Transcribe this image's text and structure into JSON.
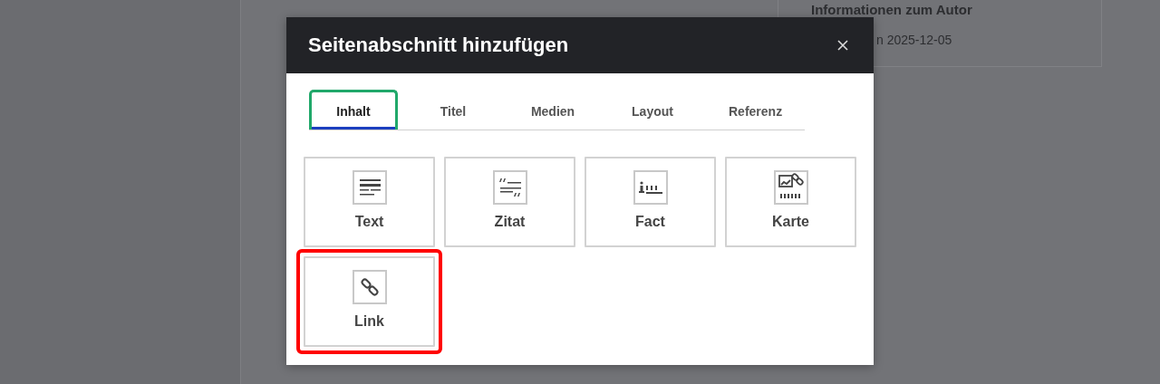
{
  "background": {
    "author_card": {
      "title": "Informationen zum Autor",
      "date": "n 2025-12-05"
    }
  },
  "dialog": {
    "title": "Seitenabschnitt hinzufügen",
    "tabs": [
      {
        "label": "Inhalt",
        "selected": true,
        "focused": true
      },
      {
        "label": "Titel",
        "selected": false,
        "focused": false
      },
      {
        "label": "Medien",
        "selected": false,
        "focused": false
      },
      {
        "label": "Layout",
        "selected": false,
        "focused": false
      },
      {
        "label": "Referenz",
        "selected": false,
        "focused": false
      }
    ],
    "tiles": [
      {
        "kind": "text",
        "label": "Text",
        "highlighted": false
      },
      {
        "kind": "quote",
        "label": "Zitat",
        "highlighted": false
      },
      {
        "kind": "fact",
        "label": "Fact",
        "highlighted": false
      },
      {
        "kind": "card",
        "label": "Karte",
        "highlighted": false
      },
      {
        "kind": "link",
        "label": "Link",
        "highlighted": true
      }
    ]
  }
}
